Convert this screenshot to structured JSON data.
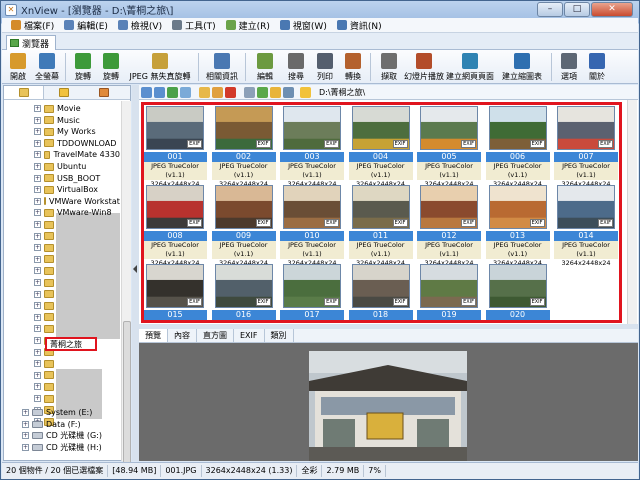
{
  "window": {
    "title": "XnView - [瀏覽器 - D:\\菁桐之旅\\]",
    "app_icon": "xnview-icon"
  },
  "menu": [
    "檔案(F)",
    "編輯(E)",
    "檢視(V)",
    "工具(T)",
    "建立(R)",
    "視窗(W)",
    "資訊(N)"
  ],
  "tab": {
    "label": "瀏覽器"
  },
  "toolbar": [
    {
      "label": "開啟",
      "icon": "open-folder-icon",
      "color": "#d79a2c"
    },
    {
      "label": "全螢幕",
      "icon": "fullscreen-icon",
      "color": "#3f7ab8"
    },
    {
      "label": "旋轉",
      "icon": "rotate-left-icon",
      "color": "#3d9a3a"
    },
    {
      "label": "旋轉",
      "icon": "rotate-right-icon",
      "color": "#3d9a3a"
    },
    {
      "label": "JPEG 無失真旋轉",
      "icon": "jpeg-lossless-icon",
      "color": "#c6a03a"
    },
    {
      "label": "相關資訊",
      "icon": "info-icon",
      "color": "#4a78b2"
    },
    {
      "label": "編輯",
      "icon": "edit-icon",
      "color": "#6c9a40"
    },
    {
      "label": "搜尋",
      "icon": "search-icon",
      "color": "#6a6a6a"
    },
    {
      "label": "列印",
      "icon": "print-icon",
      "color": "#555f6e"
    },
    {
      "label": "轉換",
      "icon": "convert-icon",
      "color": "#b4612d"
    },
    {
      "label": "擷取",
      "icon": "capture-icon",
      "color": "#6e6e6e"
    },
    {
      "label": "幻燈片播放",
      "icon": "slideshow-icon",
      "color": "#b34d2a"
    },
    {
      "label": "建立網頁頁面",
      "icon": "webpage-icon",
      "color": "#2f83b3"
    },
    {
      "label": "建立縮圖表",
      "icon": "contact-sheet-icon",
      "color": "#2e6fb0"
    },
    {
      "label": "選項",
      "icon": "gear-icon",
      "color": "#5d6774"
    },
    {
      "label": "關於",
      "icon": "about-icon",
      "color": "#3666b0"
    }
  ],
  "tree": {
    "items": [
      "Movie",
      "Music",
      "My Works",
      "TDDOWNLOAD",
      "TravelMate 4330",
      "Ubuntu",
      "USB_BOOT",
      "VirtualBox",
      "VMWare Workstation",
      "VMware-Win8"
    ],
    "selected": "菁桐之旅",
    "drives": [
      "System (E:)",
      "Data (F:)",
      "CD 光碟機 (G:)",
      "CD 光碟機 (H:)"
    ]
  },
  "nav": {
    "path": "D:\\菁桐之旅\\"
  },
  "thumbnails": [
    {
      "name": "001",
      "info": "JPEG TrueColor (v1.1)",
      "size": "3264x2448x24",
      "colors": [
        "#5a6b7a",
        "#c9cbc4",
        "#3a4552"
      ]
    },
    {
      "name": "002",
      "info": "JPEG TrueColor (v1.1)",
      "size": "3264x2448x24",
      "colors": [
        "#7a5a34",
        "#c59a55",
        "#3c6a3c"
      ]
    },
    {
      "name": "003",
      "info": "JPEG TrueColor (v1.1)",
      "size": "3264x2448x24",
      "colors": [
        "#6c7d5a",
        "#dfe7ee",
        "#4f6b3d"
      ]
    },
    {
      "name": "004",
      "info": "JPEG TrueColor (v1.1)",
      "size": "3264x2448x24",
      "colors": [
        "#4d6e3e",
        "#d7dad4",
        "#c7a235"
      ]
    },
    {
      "name": "005",
      "info": "JPEG TrueColor (v1.1)",
      "size": "3264x2448x24",
      "colors": [
        "#5b7a4e",
        "#e5e9ec",
        "#d48b2e"
      ]
    },
    {
      "name": "006",
      "info": "JPEG TrueColor (v1.1)",
      "size": "3264x2448x24",
      "colors": [
        "#3f6b35",
        "#cfe0ea",
        "#7d5f38"
      ]
    },
    {
      "name": "007",
      "info": "JPEG TrueColor (v1.1)",
      "size": "3264x2448x24",
      "colors": [
        "#5b6170",
        "#e6e4de",
        "#c94a3c"
      ]
    },
    {
      "name": "008",
      "info": "JPEG TrueColor (v1.1)",
      "size": "3264x2448x24",
      "colors": [
        "#b8322e",
        "#d7d1c6",
        "#3d3a38"
      ]
    },
    {
      "name": "009",
      "info": "JPEG TrueColor (v1.1)",
      "size": "3264x2448x24",
      "colors": [
        "#7b4a2e",
        "#d9b895",
        "#4d3a2c"
      ]
    },
    {
      "name": "010",
      "info": "JPEG TrueColor (v1.1)",
      "size": "3264x2448x24",
      "colors": [
        "#6a4e36",
        "#e1d3bb",
        "#9b6d43"
      ]
    },
    {
      "name": "011",
      "info": "JPEG TrueColor (v1.1)",
      "size": "3264x2448x24",
      "colors": [
        "#5a5a4e",
        "#ded7c2",
        "#7a6c4a"
      ]
    },
    {
      "name": "012",
      "info": "JPEG TrueColor (v1.1)",
      "size": "3264x2448x24",
      "colors": [
        "#8a4a2e",
        "#e8cfae",
        "#b9783f"
      ]
    },
    {
      "name": "013",
      "info": "JPEG TrueColor (v1.1)",
      "size": "3264x2448x24",
      "colors": [
        "#b96a32",
        "#efe3cf",
        "#d28b45"
      ]
    },
    {
      "name": "014",
      "info": "JPEG TrueColor (v1.1)",
      "size": "3264x2448x24",
      "colors": [
        "#4d6b8a",
        "#e4e8ec",
        "#3d4e5a"
      ]
    },
    {
      "name": "015",
      "info": "",
      "size": "",
      "colors": [
        "#34312c",
        "#d8d6cf",
        "#56524a"
      ]
    },
    {
      "name": "016",
      "info": "",
      "size": "",
      "colors": [
        "#52606a",
        "#d8dcd8",
        "#3f4a3e"
      ]
    },
    {
      "name": "017",
      "info": "",
      "size": "",
      "colors": [
        "#4b6e3e",
        "#ccd6d9",
        "#5a7c49"
      ]
    },
    {
      "name": "018",
      "info": "",
      "size": "",
      "colors": [
        "#6a5e52",
        "#d7d4cb",
        "#4a4a44"
      ]
    },
    {
      "name": "019",
      "info": "",
      "size": "",
      "colors": [
        "#5f7a45",
        "#d6dce0",
        "#7b6a50"
      ]
    },
    {
      "name": "020",
      "info": "",
      "size": "",
      "colors": [
        "#56704a",
        "#c9d4d9",
        "#3e5a33"
      ]
    }
  ],
  "info_tabs": [
    "預覽",
    "內容",
    "直方圖",
    "EXIF",
    "類別"
  ],
  "status": [
    "20 個物件 / 20 個已選檔案",
    "[48.94 MB]",
    "001.JPG",
    "3264x2448x24 (1.33)",
    "全彩",
    "2.79 MB",
    "7%"
  ]
}
